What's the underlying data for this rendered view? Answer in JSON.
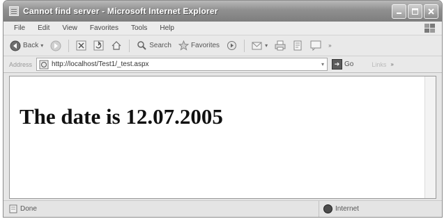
{
  "window": {
    "title": "Cannot find server - Microsoft Internet Explorer"
  },
  "menu": {
    "items": [
      "File",
      "Edit",
      "View",
      "Favorites",
      "Tools",
      "Help"
    ]
  },
  "toolbar": {
    "back_label": "Back",
    "search_label": "Search",
    "favorites_label": "Favorites"
  },
  "address": {
    "label": "Address",
    "url": "http://localhost/Test1/_test.aspx",
    "go_label": "Go",
    "links_label": "Links"
  },
  "page": {
    "heading": "The date is 12.07.2005"
  },
  "status": {
    "text": "Done",
    "zone": "Internet"
  }
}
